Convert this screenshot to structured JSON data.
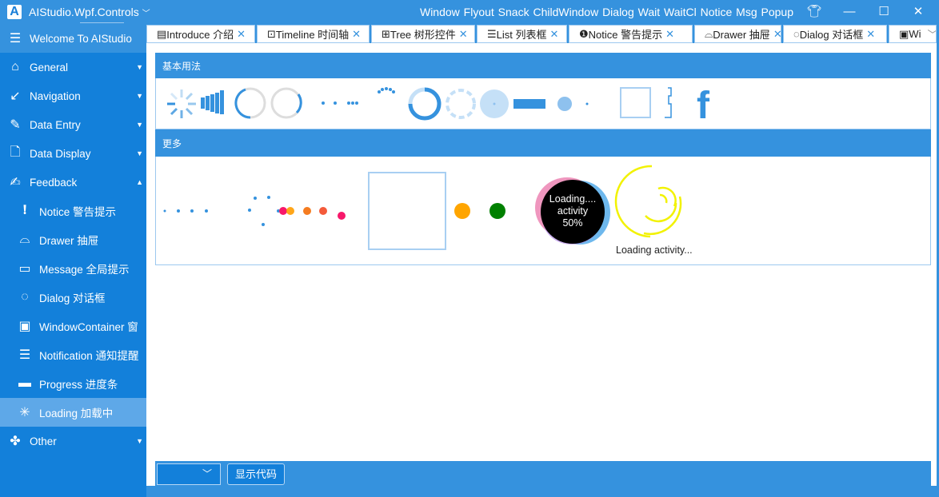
{
  "app": {
    "title": "AIStudio.Wpf.Controls",
    "menu": "Window Flyout Snack ChildWindow Dialog Wait WaitCl Notice Msg Popup"
  },
  "sidebar": {
    "welcome": "Welcome To AIStudio",
    "items": [
      {
        "label": "General",
        "icon": "home-icon",
        "arrow": "▼"
      },
      {
        "label": "Navigation",
        "icon": "arrow-circle-icon",
        "arrow": "▼"
      },
      {
        "label": "Data Entry",
        "icon": "edit-icon",
        "arrow": "▼"
      },
      {
        "label": "Data Display",
        "icon": "document-search-icon",
        "arrow": "▼"
      },
      {
        "label": "Feedback",
        "icon": "feedback-icon",
        "arrow": "▲"
      },
      {
        "label": "Notice 警告提示",
        "icon": "exclamation-icon",
        "sub": true
      },
      {
        "label": "Drawer 抽屉",
        "icon": "inbox-icon",
        "sub": true
      },
      {
        "label": "Message 全局提示",
        "icon": "folder-icon",
        "sub": true
      },
      {
        "label": "Dialog 对话框",
        "icon": "chat-icon",
        "sub": true
      },
      {
        "label": "WindowContainer 窗",
        "icon": "window-icon",
        "sub": true
      },
      {
        "label": "Notification 通知提醒",
        "icon": "notification-icon",
        "sub": true
      },
      {
        "label": "Progress 进度条",
        "icon": "progress-icon",
        "sub": true
      },
      {
        "label": "Loading 加载中",
        "icon": "loading-icon",
        "sub": true,
        "selected": true
      },
      {
        "label": "Other",
        "icon": "clover-icon",
        "arrow": "▼"
      }
    ]
  },
  "tabs": [
    {
      "label": "Introduce 介绍",
      "icon": "▤"
    },
    {
      "label": "Timeline 时间轴",
      "icon": "⊡"
    },
    {
      "label": "Tree 树形控件",
      "icon": "⊞"
    },
    {
      "label": "List 列表框",
      "icon": "☰"
    },
    {
      "label": "Notice 警告提示",
      "icon": "❶"
    },
    {
      "label": "Drawer 抽屉",
      "icon": "⌓"
    },
    {
      "label": "Dialog 对话框",
      "icon": "◌"
    },
    {
      "label": "Wi",
      "icon": "▣"
    }
  ],
  "sections": {
    "basic": "基本用法",
    "more": "更多"
  },
  "loaders": {
    "circle_text": [
      "Loading....",
      "activity",
      "50%"
    ],
    "caption": "Loading activity..."
  },
  "footer": {
    "show_code": "显示代码",
    "combo_value": ""
  },
  "colors": {
    "accent": "#3592de",
    "sidebar": "#1380da",
    "selected": "#5ea8e8"
  }
}
